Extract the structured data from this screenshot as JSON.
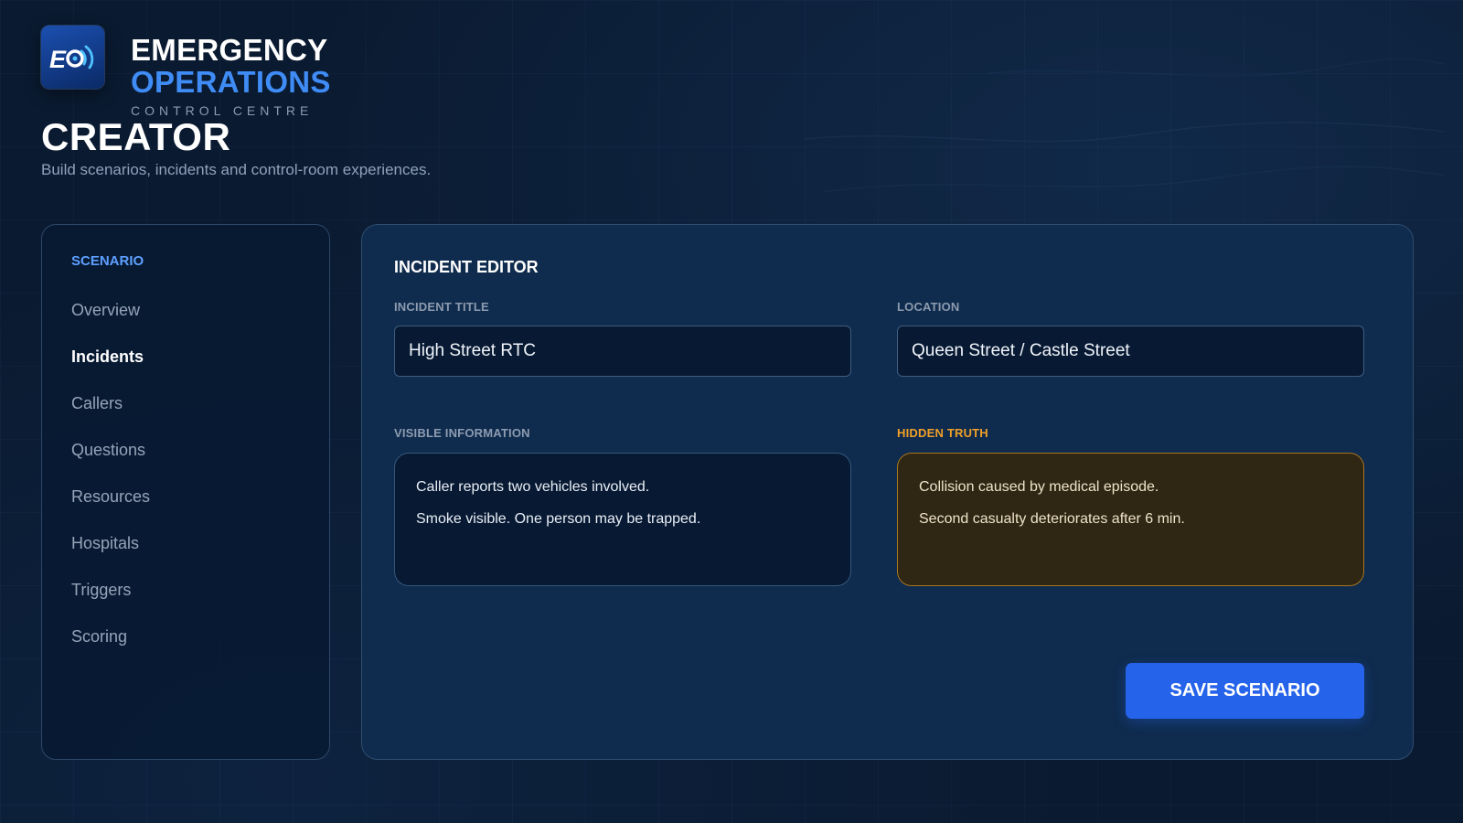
{
  "brand": {
    "line1": "EMERGENCY",
    "line2": "OPERATIONS",
    "line3": "CONTROL CENTRE",
    "logo_icon": "eo-broadcast-logo",
    "accent_color": "#3f8cf6"
  },
  "page": {
    "title": "CREATOR",
    "subtitle": "Build scenarios, incidents and control-room experiences."
  },
  "sidebar": {
    "heading": "SCENARIO",
    "items": [
      {
        "label": "Overview",
        "active": false
      },
      {
        "label": "Incidents",
        "active": true
      },
      {
        "label": "Callers",
        "active": false
      },
      {
        "label": "Questions",
        "active": false
      },
      {
        "label": "Resources",
        "active": false
      },
      {
        "label": "Hospitals",
        "active": false
      },
      {
        "label": "Triggers",
        "active": false
      },
      {
        "label": "Scoring",
        "active": false
      }
    ]
  },
  "editor": {
    "title": "INCIDENT EDITOR",
    "incident_title": {
      "label": "INCIDENT TITLE",
      "value": "High Street RTC"
    },
    "location": {
      "label": "LOCATION",
      "value": "Queen Street / Castle Street"
    },
    "visible_information": {
      "label": "VISIBLE INFORMATION",
      "lines": [
        "Caller reports two vehicles involved.",
        "Smoke visible. One person may be trapped."
      ]
    },
    "hidden_truth": {
      "label": "HIDDEN TRUTH",
      "lines": [
        "Collision caused by medical episode.",
        "Second casualty deteriorates after 6 min."
      ],
      "color": "#f0a028"
    },
    "save_label": "SAVE SCENARIO",
    "save_color": "#2563eb"
  }
}
